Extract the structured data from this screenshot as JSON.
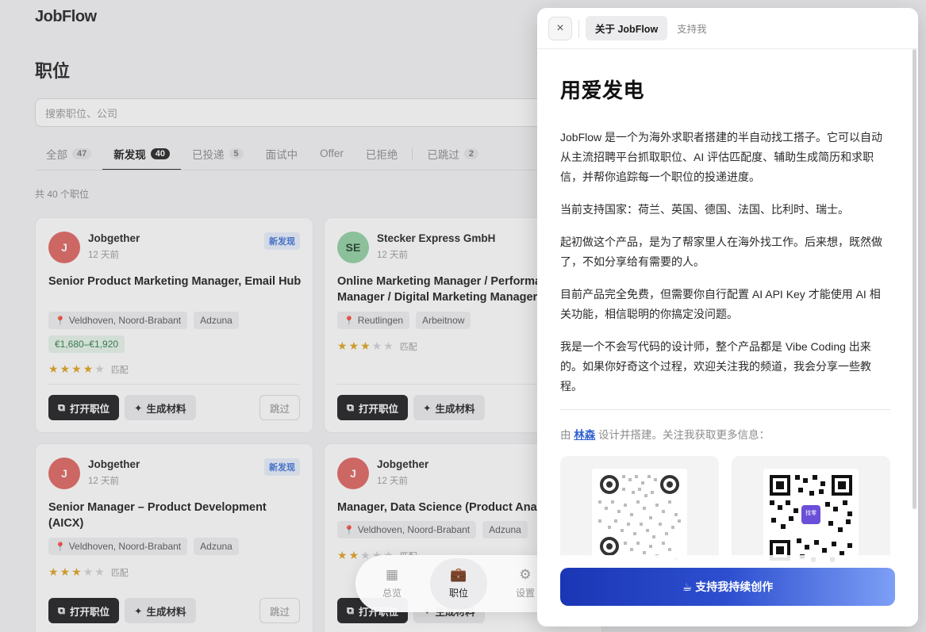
{
  "app": {
    "logo": "JobFlow",
    "page_title": "职位",
    "search_placeholder": "搜索职位、公司",
    "tabs": [
      {
        "label": "全部",
        "count": "47"
      },
      {
        "label": "新发现",
        "count": "40"
      },
      {
        "label": "已投递",
        "count": "5"
      },
      {
        "label": "面试中",
        "count": ""
      },
      {
        "label": "Offer",
        "count": ""
      },
      {
        "label": "已拒绝",
        "count": ""
      },
      {
        "label": "已跳过",
        "count": "2"
      }
    ],
    "total": "共 40 个职位",
    "cards": [
      {
        "initials": "J",
        "avatar_color": "#e0635f",
        "company": "Jobgether",
        "time": "12 天前",
        "badge": "新发现",
        "title": "Senior Product Marketing Manager, Email Hub",
        "location": "Veldhoven, Noord-Brabant",
        "source": "Adzuna",
        "salary": "€1,680–€1,920",
        "rating": 4,
        "match_label": "匹配",
        "open_label": "打开职位",
        "generate_label": "生成材料",
        "skip_label": "跳过"
      },
      {
        "initials": "SE",
        "avatar_color": "#8fd0a0",
        "company": "Stecker Express GmbH",
        "time": "12 天前",
        "badge": "",
        "title": "Online Marketing Manager / Performance Manager / Digital Marketing Manager",
        "location": "Reutlingen",
        "source": "Arbeitnow",
        "salary": "",
        "rating": 3,
        "match_label": "匹配",
        "open_label": "打开职位",
        "generate_label": "生成材料",
        "skip_label": ""
      },
      {
        "initials": "J",
        "avatar_color": "#e0635f",
        "company": "Jobgether",
        "time": "12 天前",
        "badge": "新发现",
        "title": "Senior Manager – Product Development (AICX)",
        "location": "Veldhoven, Noord-Brabant",
        "source": "Adzuna",
        "salary": "",
        "rating": 3,
        "match_label": "匹配",
        "open_label": "打开职位",
        "generate_label": "生成材料",
        "skip_label": "跳过"
      },
      {
        "initials": "J",
        "avatar_color": "#e0635f",
        "company": "Jobgether",
        "time": "12 天前",
        "badge": "",
        "title": "Manager, Data Science (Product Analytics)",
        "location": "Veldhoven, Noord-Brabant",
        "source": "Adzuna",
        "salary": "",
        "rating": 2,
        "match_label": "匹配",
        "open_label": "打开职位",
        "generate_label": "生成材料",
        "skip_label": ""
      }
    ],
    "bottom_nav": [
      {
        "label": "总览",
        "icon": "grid-icon"
      },
      {
        "label": "职位",
        "icon": "briefcase-icon"
      },
      {
        "label": "设置",
        "icon": "gear-icon"
      }
    ]
  },
  "panel": {
    "close_label": "×",
    "tabs": [
      "关于 JobFlow",
      "支持我"
    ],
    "title": "用爱发电",
    "paragraphs": [
      "JobFlow 是一个为海外求职者搭建的半自动找工搭子。它可以自动从主流招聘平台抓取职位、AI 评估匹配度、辅助生成简历和求职信，并帮你追踪每一个职位的投递进度。",
      "当前支持国家：荷兰、英国、德国、法国、比利时、瑞士。",
      "起初做这个产品，是为了帮家里人在海外找工作。后来想，既然做了，不如分享给有需要的人。",
      "目前产品完全免费，但需要你自行配置 AI API Key 才能使用 AI 相关功能，相信聪明的你搞定没问题。",
      "我是一个不会写代码的设计师，整个产品都是 Vibe Coding 出来的。如果你好奇这个过程，欢迎关注我的频道，我会分享一些教程。"
    ],
    "credit_prefix": "由",
    "credit_author": "林森",
    "credit_suffix": "设计并搭建。关注我获取更多信息：",
    "qr_badge": "找零",
    "cta_label": "☕ 支持我持续创作",
    "accent": "#2d4fcf"
  }
}
